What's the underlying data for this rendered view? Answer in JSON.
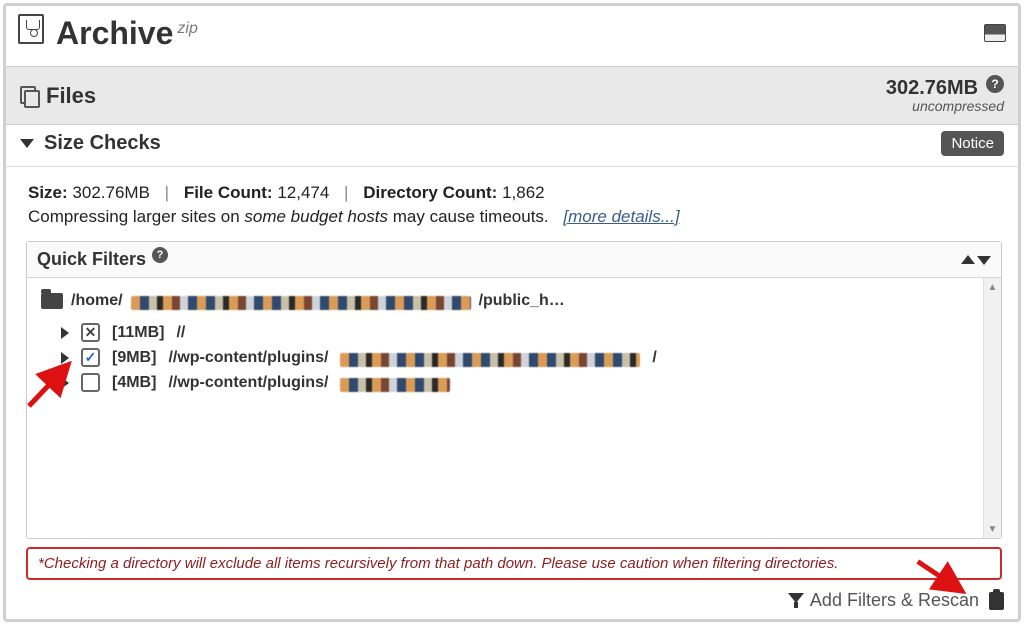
{
  "panel": {
    "title": "Archive",
    "format_sup": "zip"
  },
  "files": {
    "heading": "Files",
    "total_size": "302.76MB",
    "uncompressed_label": "uncompressed"
  },
  "size_checks": {
    "heading": "Size Checks",
    "notice_badge": "Notice"
  },
  "stats": {
    "size_label": "Size:",
    "size_value": "302.76MB",
    "file_count_label": "File Count:",
    "file_count_value": "12,474",
    "dir_count_label": "Directory Count:",
    "dir_count_value": "1,862"
  },
  "note": {
    "prefix": "Compressing larger sites on ",
    "italic": "some budget hosts",
    "suffix": " may cause timeouts.",
    "more_link": "[more details...]"
  },
  "quick_filters": {
    "heading": "Quick Filters",
    "root": {
      "prefix": "/home/",
      "suffix": "/public_h…"
    },
    "items": [
      {
        "size": "[11MB]",
        "path": "//",
        "checked": "indeterminate"
      },
      {
        "size": "[9MB]",
        "path_prefix": "//wp-content/plugins/",
        "path_suffix": "/",
        "checked": "true"
      },
      {
        "size": "[4MB]",
        "path_prefix": "//wp-content/plugins/",
        "path_suffix": "",
        "checked": "false"
      }
    ]
  },
  "caution": "*Checking a directory will exclude all items recursively from that path down. Please use caution when filtering directories.",
  "footer": {
    "add_filters": "Add Filters & Rescan"
  }
}
